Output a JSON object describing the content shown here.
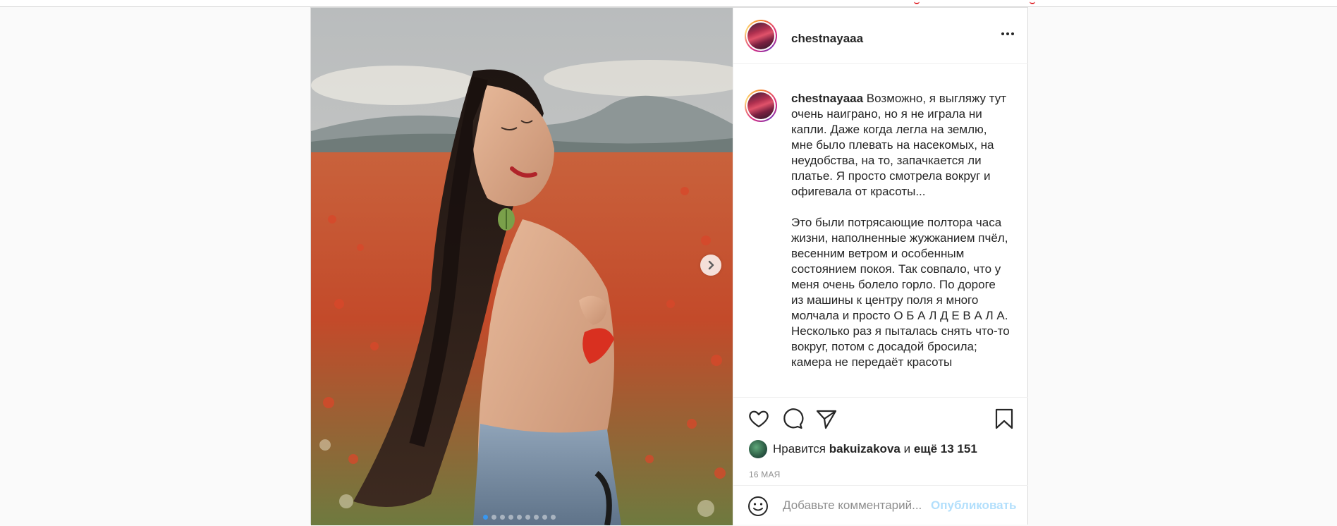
{
  "post": {
    "username": "chestnayaaa",
    "caption_username": "chestnayaaa",
    "caption_text": " Возможно, я выгляжу тут очень наиграно, но я не играла ни капли. Даже когда легла на землю, мне было плевать на насекомых, на неудобства, на то, запачкается ли платье. Я просто смотрела вокруг и офигевала от красоты...\n\nЭто были потрясающие полтора часа жизни, наполненные жужжанием пчёл, весенним ветром и особенным состоянием покоя. Так совпало, что у меня очень болело горло. По дороге из машины к центру поля я много молчала и просто О Б А Л Д Е В А Л А. Несколько раз я пыталась снять что-то вокруг, потом с досадой бросила; камера не передаёт красоты",
    "carousel": {
      "total": 9,
      "current": 1
    }
  },
  "likes": {
    "prefix": "Нравится",
    "user": "bakuizakova",
    "connector": "и",
    "others": "ещё 13 151"
  },
  "date": "16 МАЯ",
  "comment_box": {
    "placeholder": "Добавьте комментарий...",
    "publish_label": "Опубликовать"
  },
  "icons": {
    "header": [
      "more-options-icon"
    ],
    "actions": [
      "heart-icon",
      "comment-icon",
      "share-icon",
      "bookmark-icon"
    ],
    "media": [
      "chevron-right-icon"
    ],
    "comment": [
      "emoji-icon"
    ]
  },
  "colors": {
    "publish_disabled": "#b2dffc",
    "carousel_active_dot": "#3897f0",
    "secondary_text": "#8e8e8e",
    "topbar_accent": "#e0242a"
  }
}
